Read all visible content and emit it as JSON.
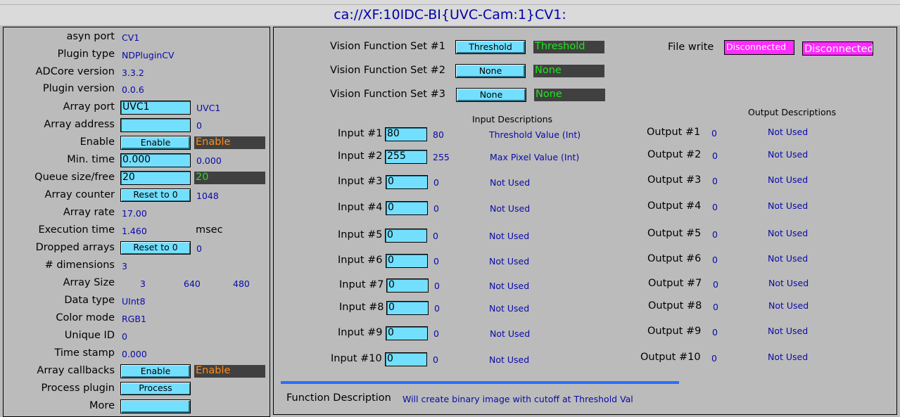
{
  "title": "ca://XF:10IDC-BI{UVC-Cam:1}CV1:",
  "left": {
    "asyn_port": {
      "label": "asyn port",
      "value": "CV1"
    },
    "plugin_type": {
      "label": "Plugin type",
      "value": "NDPluginCV"
    },
    "adcore_version": {
      "label": "ADCore version",
      "value": "3.3.2"
    },
    "plugin_version": {
      "label": "Plugin version",
      "value": "0.0.6"
    },
    "array_port": {
      "label": "Array port",
      "input": "UVC1",
      "value": "UVC1"
    },
    "array_address": {
      "label": "Array address",
      "input": "",
      "value": "0"
    },
    "enable": {
      "label": "Enable",
      "button": "Enable",
      "value": "Enable"
    },
    "min_time": {
      "label": "Min. time",
      "input": "0.000",
      "value": "0.000"
    },
    "queue": {
      "label": "Queue size/free",
      "input": "20",
      "value": "20"
    },
    "array_counter": {
      "label": "Array counter",
      "button": "Reset to 0",
      "value": "1048"
    },
    "array_rate": {
      "label": "Array rate",
      "value": "17.00"
    },
    "execution_time": {
      "label": "Execution time",
      "value": "1.460",
      "unit": "msec"
    },
    "dropped_arrays": {
      "label": "Dropped arrays",
      "button": "Reset to 0",
      "value": "0"
    },
    "dimensions": {
      "label": "# dimensions",
      "value": "3"
    },
    "array_size": {
      "label": "Array Size",
      "v1": "3",
      "v2": "640",
      "v3": "480"
    },
    "data_type": {
      "label": "Data type",
      "value": "UInt8"
    },
    "color_mode": {
      "label": "Color mode",
      "value": "RGB1"
    },
    "unique_id": {
      "label": "Unique ID",
      "value": "0"
    },
    "time_stamp": {
      "label": "Time stamp",
      "value": "0.000"
    },
    "array_callbacks": {
      "label": "Array callbacks",
      "button": "Enable",
      "value": "Enable"
    },
    "process_plugin": {
      "label": "Process plugin",
      "button": "Process"
    },
    "more": {
      "label": "More",
      "button": ""
    }
  },
  "right": {
    "vfs": [
      {
        "label": "Vision Function Set #1",
        "menu": "Threshold",
        "value": "Threshold"
      },
      {
        "label": "Vision Function Set #2",
        "menu": "None",
        "value": "None"
      },
      {
        "label": "Vision Function Set #3",
        "menu": "None",
        "value": "None"
      }
    ],
    "file_write": {
      "label": "File write",
      "menu": "Disconnected",
      "value": "Disconnected"
    },
    "input_header": "Input Descriptions",
    "output_header": "Output Descriptions",
    "inputs": [
      {
        "label": "Input #1",
        "input": "80",
        "value": "80",
        "desc": "Threshold Value (Int)"
      },
      {
        "label": "Input #2",
        "input": "255",
        "value": "255",
        "desc": "Max Pixel Value (Int)"
      },
      {
        "label": "Input #3",
        "input": "0",
        "value": "0",
        "desc": "Not Used"
      },
      {
        "label": "Input #4",
        "input": "0",
        "value": "0",
        "desc": "Not Used"
      },
      {
        "label": "Input #5",
        "input": "0",
        "value": "0",
        "desc": "Not Used"
      },
      {
        "label": "Input #6",
        "input": "0",
        "value": "0",
        "desc": "Not Used"
      },
      {
        "label": "Input #7",
        "input": "0",
        "value": "0",
        "desc": "Not Used"
      },
      {
        "label": "Input #8",
        "input": "0",
        "value": "0",
        "desc": "Not Used"
      },
      {
        "label": "Input #9",
        "input": "0",
        "value": "0",
        "desc": "Not Used"
      },
      {
        "label": "Input #10",
        "input": "0",
        "value": "0",
        "desc": "Not Used"
      }
    ],
    "outputs": [
      {
        "label": "Output #1",
        "value": "0",
        "desc": "Not Used"
      },
      {
        "label": "Output #2",
        "value": "0",
        "desc": "Not Used"
      },
      {
        "label": "Output #3",
        "value": "0",
        "desc": "Not Used"
      },
      {
        "label": "Output #4",
        "value": "0",
        "desc": "Not Used"
      },
      {
        "label": "Output #5",
        "value": "0",
        "desc": "Not Used"
      },
      {
        "label": "Output #6",
        "value": "0",
        "desc": "Not Used"
      },
      {
        "label": "Output #7",
        "value": "0",
        "desc": "Not Used"
      },
      {
        "label": "Output #8",
        "value": "0",
        "desc": "Not Used"
      },
      {
        "label": "Output #9",
        "value": "0",
        "desc": "Not Used"
      },
      {
        "label": "Output #10",
        "value": "0",
        "desc": "Not Used"
      }
    ],
    "function_description": {
      "label": "Function Description",
      "value": "Will create binary image with cutoff at Threshold Val"
    }
  },
  "colors": {
    "background": "#bbbbbb",
    "control": "#73dfff",
    "monitor_text": "#0a0aa8",
    "readback_bg": "#404040",
    "enable_text": "#ff8c1a",
    "green_text": "#1ee61e",
    "alarm": "#ff2bff",
    "rule": "#2a6eff"
  }
}
